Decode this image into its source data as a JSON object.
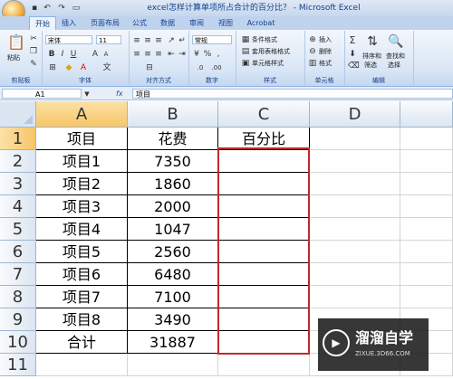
{
  "window": {
    "title": "excel怎样计算单项所占合计的百分比？ - Microsoft Excel"
  },
  "tabs": [
    "开始",
    "插入",
    "页面布局",
    "公式",
    "数据",
    "审阅",
    "视图",
    "Acrobat"
  ],
  "ribbon": {
    "clipboard": {
      "paste": "粘贴",
      "label": "剪贴板"
    },
    "font": {
      "family": "宋体",
      "size": "11",
      "label": "字体",
      "bold": "B",
      "italic": "I",
      "underline": "U",
      "grow": "A",
      "shrink": "A"
    },
    "alignment": {
      "label": "对齐方式"
    },
    "number": {
      "format": "常规",
      "label": "数字"
    },
    "styles": {
      "conditional": "条件格式",
      "table": "套用表格格式",
      "cell": "单元格样式",
      "label": "样式"
    },
    "cells": {
      "insert": "插入",
      "delete": "删除",
      "format": "格式",
      "label": "单元格"
    },
    "editing": {
      "sort": "排序和",
      "sort2": "筛选",
      "find": "查找和",
      "find2": "选择",
      "label": "编辑",
      "sigma": "Σ"
    }
  },
  "formula_bar": {
    "name_box": "A1",
    "fx": "fx",
    "content": "项目"
  },
  "columns": [
    "A",
    "B",
    "C",
    "D"
  ],
  "rows": [
    "1",
    "2",
    "3",
    "4",
    "5",
    "6",
    "7",
    "8",
    "9",
    "10",
    "11"
  ],
  "table": [
    [
      "项目",
      "花费",
      "百分比"
    ],
    [
      "项目1",
      "7350",
      ""
    ],
    [
      "项目2",
      "1860",
      ""
    ],
    [
      "项目3",
      "2000",
      ""
    ],
    [
      "项目4",
      "1047",
      ""
    ],
    [
      "项目5",
      "2560",
      ""
    ],
    [
      "项目6",
      "6480",
      ""
    ],
    [
      "项目7",
      "7100",
      ""
    ],
    [
      "项目8",
      "3490",
      ""
    ],
    [
      "合计",
      "31887",
      ""
    ]
  ],
  "watermark": {
    "title": "溜溜自学",
    "subtitle": "ZIXUE.3D66.COM"
  },
  "colors": {
    "highlight": "#c0282e",
    "selected_header": "#f7c667"
  }
}
